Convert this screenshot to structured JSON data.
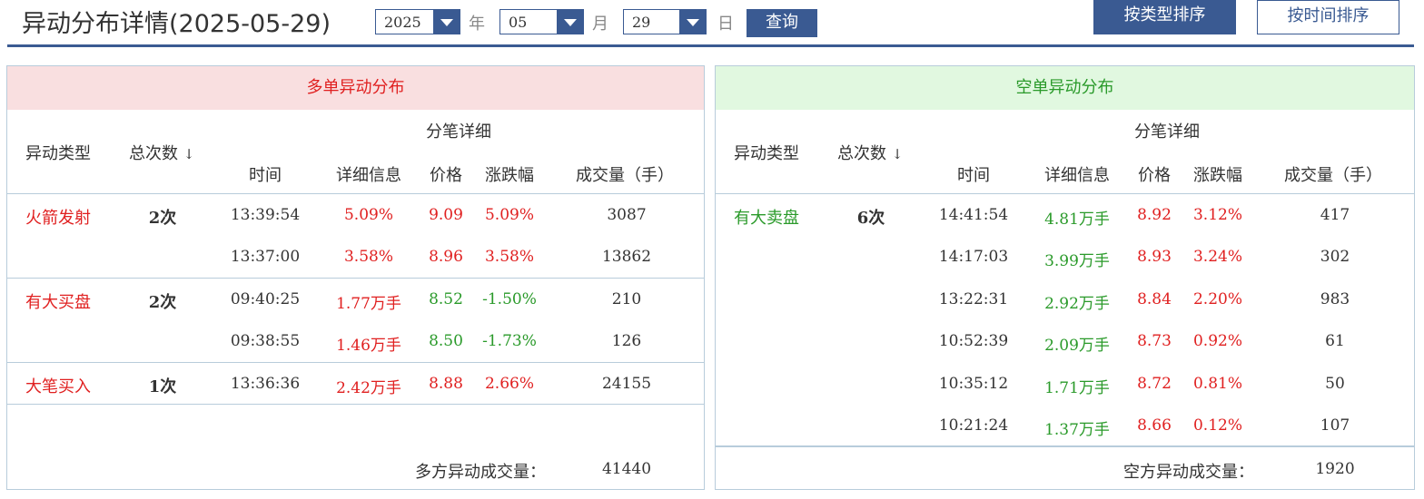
{
  "title": "异动分布详情(2025-05-29)",
  "filters": {
    "year": "2025",
    "year_unit": "年",
    "month": "05",
    "month_unit": "月",
    "day": "29",
    "day_unit": "日",
    "query_label": "查询"
  },
  "sort_buttons": {
    "by_type": "按类型排序",
    "by_time": "按时间排序"
  },
  "colors": {
    "accent": "#3a5a92",
    "up": "#e02020",
    "down": "#2a9a2a"
  },
  "columns": {
    "type": "异动类型",
    "total": "总次数",
    "sort_icon": "↓",
    "detail": "分笔详细",
    "time": "时间",
    "info": "详细信息",
    "price": "价格",
    "change": "涨跌幅",
    "volume": "成交量（手）"
  },
  "long_panel": {
    "title": "多单异动分布",
    "groups": [
      {
        "type": "火箭发射",
        "count": "2次",
        "rows": [
          {
            "time": "13:39:54",
            "info": "5.09%",
            "price": "9.09",
            "change": "5.09%",
            "volume": "3087"
          },
          {
            "time": "13:37:00",
            "info": "3.58%",
            "price": "8.96",
            "change": "3.58%",
            "volume": "13862"
          }
        ]
      },
      {
        "type": "有大买盘",
        "count": "2次",
        "rows": [
          {
            "time": "09:40:25",
            "info": "1.77万手",
            "price": "8.52",
            "change": "-1.50%",
            "volume": "210"
          },
          {
            "time": "09:38:55",
            "info": "1.46万手",
            "price": "8.50",
            "change": "-1.73%",
            "volume": "126"
          }
        ]
      },
      {
        "type": "大笔买入",
        "count": "1次",
        "rows": [
          {
            "time": "13:36:36",
            "info": "2.42万手",
            "price": "8.88",
            "change": "2.66%",
            "volume": "24155"
          }
        ]
      }
    ],
    "footer_label": "多方异动成交量：",
    "footer_value": "41440"
  },
  "short_panel": {
    "title": "空单异动分布",
    "groups": [
      {
        "type": "有大卖盘",
        "count": "6次",
        "rows": [
          {
            "time": "14:41:54",
            "info": "4.81万手",
            "price": "8.92",
            "change": "3.12%",
            "volume": "417"
          },
          {
            "time": "14:17:03",
            "info": "3.99万手",
            "price": "8.93",
            "change": "3.24%",
            "volume": "302"
          },
          {
            "time": "13:22:31",
            "info": "2.92万手",
            "price": "8.84",
            "change": "2.20%",
            "volume": "983"
          },
          {
            "time": "10:52:39",
            "info": "2.09万手",
            "price": "8.73",
            "change": "0.92%",
            "volume": "61"
          },
          {
            "time": "10:35:12",
            "info": "1.71万手",
            "price": "8.72",
            "change": "0.81%",
            "volume": "50"
          },
          {
            "time": "10:21:24",
            "info": "1.37万手",
            "price": "8.66",
            "change": "0.12%",
            "volume": "107"
          }
        ]
      }
    ],
    "footer_label": "空方异动成交量：",
    "footer_value": "1920"
  }
}
